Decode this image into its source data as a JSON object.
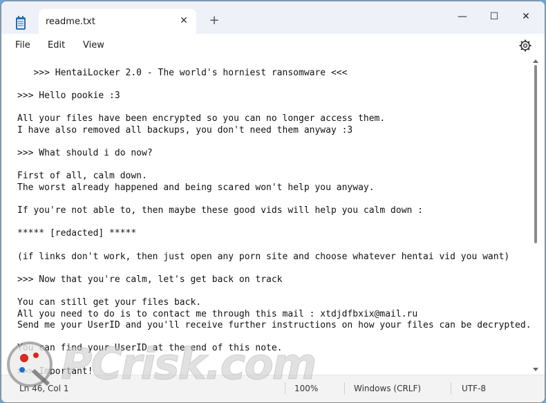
{
  "tab": {
    "title": "readme.txt",
    "close_glyph": "✕",
    "new_tab_glyph": "+"
  },
  "window_controls": {
    "minimize": "—",
    "maximize": "☐",
    "close": "✕"
  },
  "menu": {
    "file": "File",
    "edit": "Edit",
    "view": "View"
  },
  "document": {
    "lines": [
      "   >>> HentaiLocker 2.0 - The world's horniest ransomware <<<",
      "",
      ">>> Hello pookie :3",
      "",
      "All your files have been encrypted so you can no longer access them.",
      "I have also removed all backups, you don't need them anyway :3",
      "",
      ">>> What should i do now?",
      "",
      "First of all, calm down.",
      "The worst already happened and being scared won't help you anyway.",
      "",
      "If you're not able to, then maybe these good vids will help you calm down :",
      "",
      "***** [redacted] *****",
      "",
      "(if links don't work, then just open any porn site and choose whatever hentai vid you want)",
      "",
      ">>> Now that you're calm, let's get back on track",
      "",
      "You can still get your files back.",
      "All you need to do is to contact me through this mail : xtdjdfbxix@mail.ru",
      "Send me your UserID and you'll receive further instructions on how your files can be decrypted.",
      "",
      "You can find your UserID at the end of this note.",
      "",
      ">>> Important!"
    ]
  },
  "status": {
    "position": "Ln 46, Col 1",
    "zoom": "100%",
    "line_ending": "Windows (CRLF)",
    "encoding": "UTF-8"
  },
  "watermark": {
    "text": "PCrisk.com"
  },
  "icons": [
    "notepad-icon",
    "close-tab-icon",
    "new-tab-icon",
    "minimize-icon",
    "maximize-icon",
    "close-window-icon",
    "settings-gear-icon",
    "pcrisk-logo-icon"
  ],
  "colors": {
    "titlebar": "#eef1f7",
    "statusbar": "#f3f3f3",
    "background": "#6aa6d6"
  }
}
